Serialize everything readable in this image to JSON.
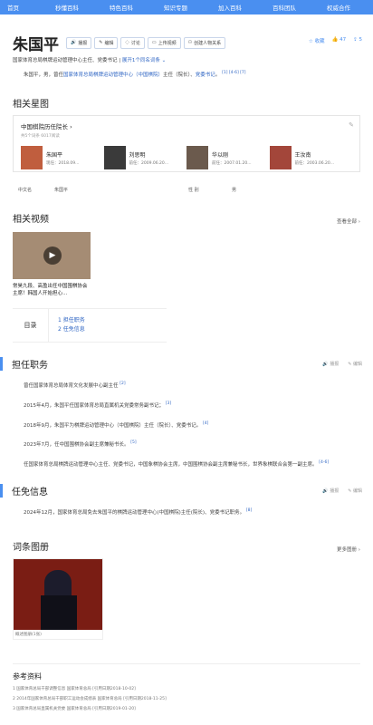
{
  "nav": [
    "首页",
    "秒懂百科",
    "特色百科",
    "知识专题",
    "加入百科",
    "百科团队",
    "权威合作"
  ],
  "entry": {
    "title": "朱国平",
    "tools": [
      "播报",
      "编辑",
      "讨论",
      "上传视频",
      "创建人物关系"
    ],
    "stats": [
      "收藏",
      "47",
      "5"
    ],
    "desc": "国家体育总局棋牌运动管理中心主任、党委书记",
    "desc_link": "展开1个同名词条",
    "summary_pre": "朱国平，男，曾任",
    "summary_link1": "国家体育总局棋牌运动管理中心（中国棋院）",
    "summary_mid": "主任（院长）、",
    "summary_link2": "党委书记",
    "summary_end": "。",
    "summary_refs": "[1] [4-6] [7]"
  },
  "stars": {
    "section": "相关星图",
    "head": "中国棋院历任院长",
    "meta": "共5个词条    6017阅读",
    "persons": [
      {
        "name": "朱国平",
        "role": "现任：2018.09..."
      },
      {
        "name": "刘思明",
        "role": "前任：2009.06.20..."
      },
      {
        "name": "华以刚",
        "role": "前任：2007.01.20..."
      },
      {
        "name": "王汝南",
        "role": "前任：2003.06.20..."
      }
    ]
  },
  "info": [
    "中文名",
    "朱国平",
    "性 别",
    "男"
  ],
  "videos": {
    "section": "相关视频",
    "more": "查看全部",
    "caption": "常昊九段、高盈出任中国围棋协会主席！韩国人开始担心..."
  },
  "toc": {
    "label": "目录",
    "items": [
      "1 担任职务",
      "2 任免信息"
    ]
  },
  "duties": {
    "title": "担任职务",
    "actions": [
      "播报",
      "编辑"
    ],
    "paras": [
      [
        "曾任国家体育总局体育文化发展中心副主任",
        "[2]"
      ],
      [
        "2015年4月，朱国平任国家体育总局直属机关党委常务副书记；",
        "[3]"
      ],
      [
        "2018年9月，朱国平为棋牌运动管理中心（中国棋院）主任（院长）、党委书记。",
        "[4]"
      ],
      [
        "2023年7月，任中国围棋协会副主席兼秘书长。",
        "[5]"
      ],
      [
        "任国家体育总局棋牌运动管理中心主任、党委书记，中国象棋协会主席，中国围棋协会副主席兼秘书长，世界象棋联合会第一副主席。",
        "[4-6]"
      ]
    ]
  },
  "appoint": {
    "title": "任免信息",
    "actions": [
      "播报",
      "编辑"
    ],
    "para": "2024年12月，国家体育总局免去朱国平的棋牌运动管理中心(中国棋院)主任(院长)、党委书记职务。",
    "ref": "[8]"
  },
  "album": {
    "title": "词条图册",
    "more": "更多图册",
    "caption": "概述图册(1张)"
  },
  "refs": {
    "title": "参考资料",
    "items": [
      "1 国家体育总局干部调整信息  国家体育总局 [引用日期2018-10-02]",
      "2 2014年国家体育总局干部职工运动会成绩表  国家体育总局 [引用日期2018-11-25]",
      "3 国家体育总局直属机关党委  国家体育总局 [引用日期2019-01-20]"
    ]
  }
}
